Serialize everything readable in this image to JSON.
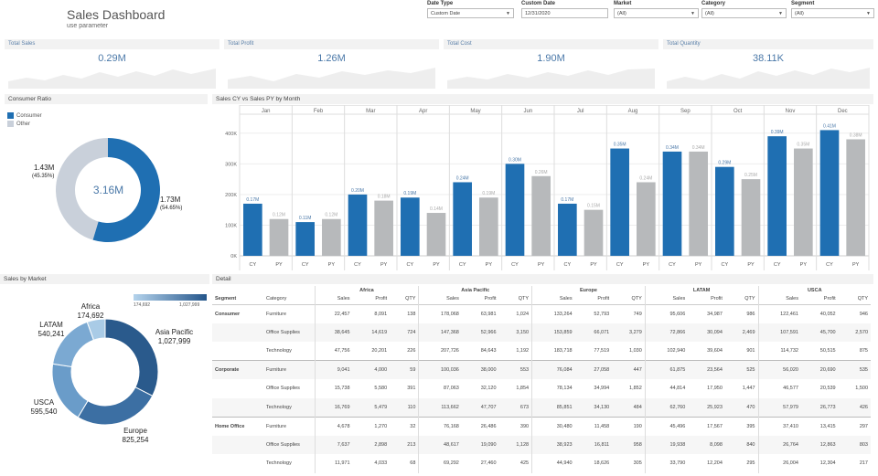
{
  "header": {
    "title": "Sales Dashboard",
    "subtitle": "use parameter"
  },
  "filters": [
    {
      "label": "Date Type",
      "value": "Custom Date"
    },
    {
      "label": "Custom Date",
      "value": "12/31/2020"
    },
    {
      "label": "Market",
      "value": "(All)"
    },
    {
      "label": "Category",
      "value": "(All)"
    },
    {
      "label": "Segment",
      "value": "(All)"
    }
  ],
  "kpis": [
    {
      "label": "Total Sales",
      "value": "0.29M"
    },
    {
      "label": "Total Profit",
      "value": "1.26M"
    },
    {
      "label": "Total Cost",
      "value": "1.90M"
    },
    {
      "label": "Total Quantity",
      "value": "38.11K"
    }
  ],
  "consumer_ratio": {
    "title": "Consumer Ratio",
    "legend": [
      "Consumer",
      "Other"
    ],
    "center_label": "3.16M",
    "consumer_value": "1.73M",
    "consumer_pct": "(54.65%)",
    "other_value": "1.43M",
    "other_pct": "(45.35%)",
    "consumer_share": 0.5465,
    "colors": {
      "consumer": "#1f6fb2",
      "other": "#c9d0da"
    }
  },
  "sales_by_market": {
    "title": "Sales by Market",
    "legend_min": "174,692",
    "legend_max": "1,027,999",
    "markets": [
      {
        "name": "Asia Pacific",
        "value": "1,027,999",
        "v": 1027999,
        "color": "#2a5a8c"
      },
      {
        "name": "Europe",
        "value": "825,254",
        "v": 825254,
        "color": "#3c6fa3"
      },
      {
        "name": "USCA",
        "value": "595,540",
        "v": 595540,
        "color": "#6a9cc9"
      },
      {
        "name": "LATAM",
        "value": "540,241",
        "v": 540241,
        "color": "#7ba9d2"
      },
      {
        "name": "Africa",
        "value": "174,692",
        "v": 174692,
        "color": "#a9cbe6"
      }
    ]
  },
  "chart_data": {
    "type": "bar",
    "title": "Sales CY vs Sales PY by Month",
    "months": [
      "Jan",
      "Feb",
      "Mar",
      "Apr",
      "May",
      "Jun",
      "Jul",
      "Aug",
      "Sep",
      "Oct",
      "Nov",
      "Dec"
    ],
    "series": [
      {
        "name": "CY",
        "color": "#1f6fb2",
        "values": [
          170000,
          110000,
          200000,
          190000,
          240000,
          300000,
          170000,
          350000,
          340000,
          290000,
          390000,
          410000
        ],
        "labels": [
          "0.17M",
          "0.11M",
          "0.20M",
          "0.19M",
          "0.24M",
          "0.30M",
          "0.17M",
          "0.35M",
          "0.34M",
          "0.29M",
          "0.39M",
          "0.41M"
        ]
      },
      {
        "name": "PY",
        "color": "#b7b9bb",
        "values": [
          120000,
          120000,
          180000,
          140000,
          190000,
          260000,
          150000,
          240000,
          340000,
          250000,
          350000,
          380000
        ],
        "labels": [
          "0.12M",
          "0.12M",
          "0.18M",
          "0.14M",
          "0.19M",
          "0.26M",
          "0.15M",
          "0.24M",
          "0.34M",
          "0.25M",
          "0.35M",
          "0.38M"
        ]
      }
    ],
    "y_ticks": [
      "0K",
      "100K",
      "200K",
      "300K",
      "400K"
    ],
    "ylim": [
      0,
      450000
    ],
    "grid": true
  },
  "detail": {
    "title": "Detail",
    "segment_header": "Segment",
    "category_header": "Category",
    "markets": [
      "Africa",
      "Asia Pacific",
      "Europe",
      "LATAM",
      "USCA"
    ],
    "measures": [
      "Sales",
      "Profit",
      "QTY"
    ],
    "rows": [
      {
        "segment": "Consumer",
        "category": "Furniture",
        "values": [
          "22,457",
          "8,091",
          "138",
          "178,068",
          "63,981",
          "1,024",
          "133,264",
          "52,793",
          "749",
          "95,606",
          "34,987",
          "986",
          "122,461",
          "40,052",
          "946"
        ]
      },
      {
        "segment": "",
        "category": "Office Supplies",
        "values": [
          "38,645",
          "14,619",
          "724",
          "147,368",
          "52,966",
          "3,150",
          "153,859",
          "66,071",
          "3,279",
          "72,866",
          "30,094",
          "2,469",
          "107,591",
          "45,700",
          "2,570"
        ]
      },
      {
        "segment": "",
        "category": "Technology",
        "values": [
          "47,756",
          "20,201",
          "226",
          "207,726",
          "84,643",
          "1,192",
          "183,718",
          "77,519",
          "1,030",
          "102,940",
          "39,604",
          "901",
          "114,732",
          "50,515",
          "875"
        ]
      },
      {
        "segment": "Corporate",
        "category": "Furniture",
        "values": [
          "9,041",
          "4,000",
          "59",
          "100,036",
          "38,000",
          "553",
          "76,084",
          "27,058",
          "447",
          "61,875",
          "23,564",
          "525",
          "56,020",
          "20,690",
          "535"
        ]
      },
      {
        "segment": "",
        "category": "Office Supplies",
        "values": [
          "15,738",
          "5,580",
          "391",
          "87,063",
          "32,120",
          "1,854",
          "78,134",
          "34,994",
          "1,852",
          "44,814",
          "17,950",
          "1,447",
          "46,577",
          "20,539",
          "1,500"
        ]
      },
      {
        "segment": "",
        "category": "Technology",
        "values": [
          "16,769",
          "5,479",
          "110",
          "113,662",
          "47,707",
          "673",
          "85,851",
          "34,130",
          "484",
          "62,760",
          "25,923",
          "470",
          "57,979",
          "26,773",
          "426"
        ]
      },
      {
        "segment": "Home Office",
        "category": "Furniture",
        "values": [
          "4,678",
          "1,270",
          "32",
          "76,168",
          "26,486",
          "390",
          "30,480",
          "11,458",
          "190",
          "45,496",
          "17,567",
          "395",
          "37,410",
          "13,415",
          "297"
        ]
      },
      {
        "segment": "",
        "category": "Office Supplies",
        "values": [
          "7,637",
          "2,898",
          "213",
          "48,617",
          "19,090",
          "1,128",
          "38,923",
          "16,811",
          "958",
          "19,938",
          "8,098",
          "840",
          "26,764",
          "12,863",
          "803"
        ]
      },
      {
        "segment": "",
        "category": "Technology",
        "values": [
          "11,971",
          "4,033",
          "68",
          "69,292",
          "27,460",
          "425",
          "44,940",
          "18,626",
          "305",
          "33,790",
          "12,204",
          "295",
          "26,004",
          "12,304",
          "217"
        ]
      }
    ]
  }
}
